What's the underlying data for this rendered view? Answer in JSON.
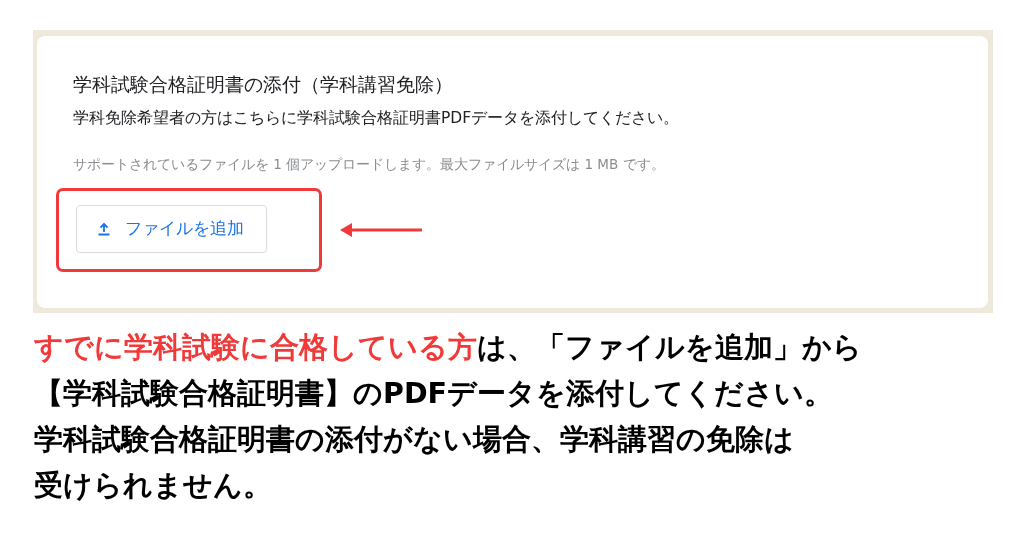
{
  "question": {
    "title": "学科試験合格証明書の添付（学科講習免除）",
    "description": "学科免除希望者の方はこちらに学科試験合格証明書PDFデータを添付してください。",
    "hint": "サポートされているファイルを 1 個アップロードします。最大ファイルサイズは 1 MB です。",
    "button": {
      "label": "ファイルを追加"
    }
  },
  "caption": {
    "highlight": "すでに学科試験に合格している方",
    "lines": [
      "は、「ファイルを追加」から",
      "【学科試験合格証明書】のPDFデータを添付してください。",
      "学科試験合格証明書の添付がない場合、学科講習の免除は",
      "受けられません。"
    ]
  }
}
